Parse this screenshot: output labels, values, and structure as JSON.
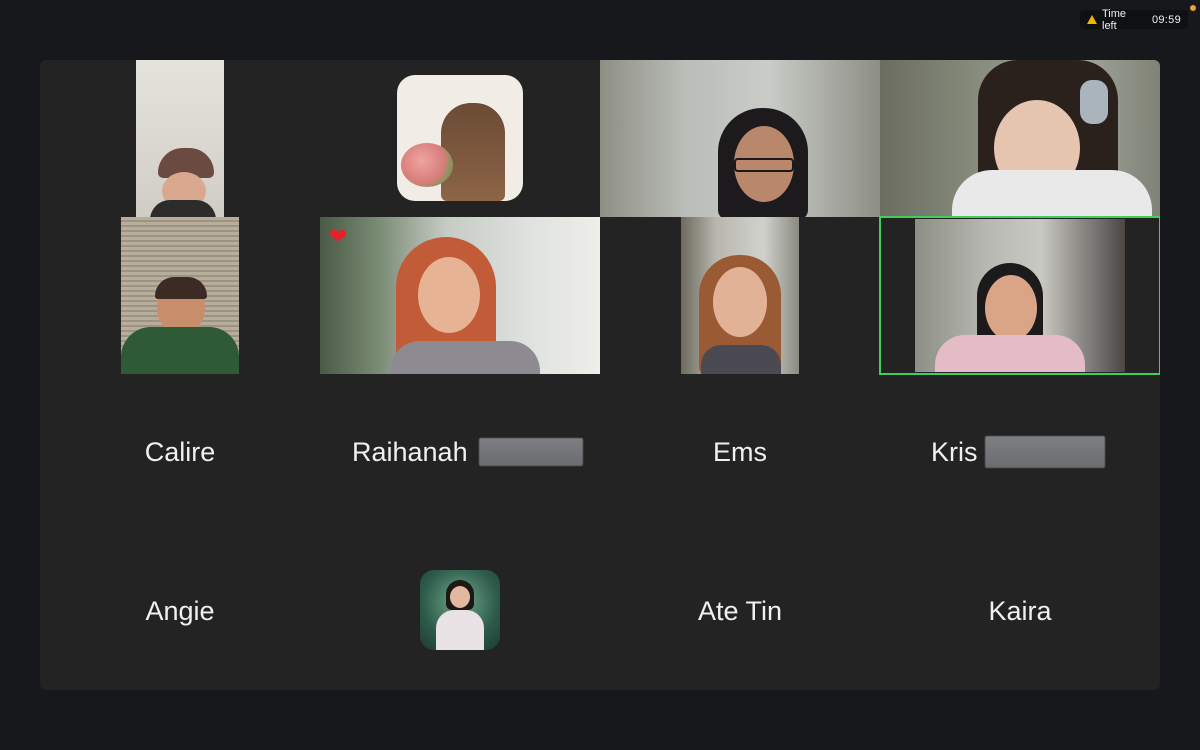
{
  "timer": {
    "label": "Time left",
    "value": "09:59",
    "icon": "warning-icon"
  },
  "reaction": {
    "icon": "heart-icon",
    "glyph": "❤"
  },
  "participants": [
    {
      "name": "Calire"
    },
    {
      "name": "Raihanah"
    },
    {
      "name": "Ems"
    },
    {
      "name": "Kris"
    },
    {
      "name": "Angie"
    },
    {
      "name": "Ate Tin"
    },
    {
      "name": "Kaira"
    }
  ],
  "colors": {
    "active_speaker_border": "#3fcf5a",
    "timer_warning": "#f2b400"
  }
}
